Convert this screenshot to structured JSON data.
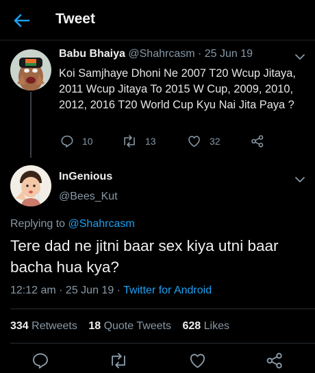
{
  "header": {
    "title": "Tweet"
  },
  "tweet1": {
    "author_name": "Babu Bhaiya",
    "author_handle": "@Shahrcasm",
    "date": "25 Jun 19",
    "separator": " · ",
    "text": "Koi Samjhaye Dhoni Ne 2007 T20 Wcup Jitaya, 2011 Wcup Jitaya To 2015 W Cup, 2009, 2010, 2012, 2016 T20 World Cup Kyu Nai Jita Paya ?",
    "replies": "10",
    "retweets": "13",
    "likes": "32"
  },
  "tweet2": {
    "author_name": "InGenious",
    "author_handle": "@Bees_Kut",
    "replying_prefix": "Replying to ",
    "replying_to": "@Shahrcasm",
    "text": "Tere dad ne jitni baar sex kiya utni baar bacha hua kya?",
    "time": "12:12 am · 25 Jun 19 · ",
    "source": "Twitter for Android",
    "retweets_count": "334",
    "retweets_label": "Retweets",
    "quotes_count": "18",
    "quotes_label": "Quote Tweets",
    "likes_count": "628",
    "likes_label": "Likes"
  },
  "icons": {
    "back": "arrow-left-icon",
    "reply": "speech-bubble-icon",
    "retweet": "retweet-icon",
    "like": "heart-icon",
    "share": "share-icon",
    "more": "chevron-down-icon"
  },
  "colors": {
    "accent": "#1da1f2",
    "background": "#000000",
    "muted": "#8899a6"
  }
}
